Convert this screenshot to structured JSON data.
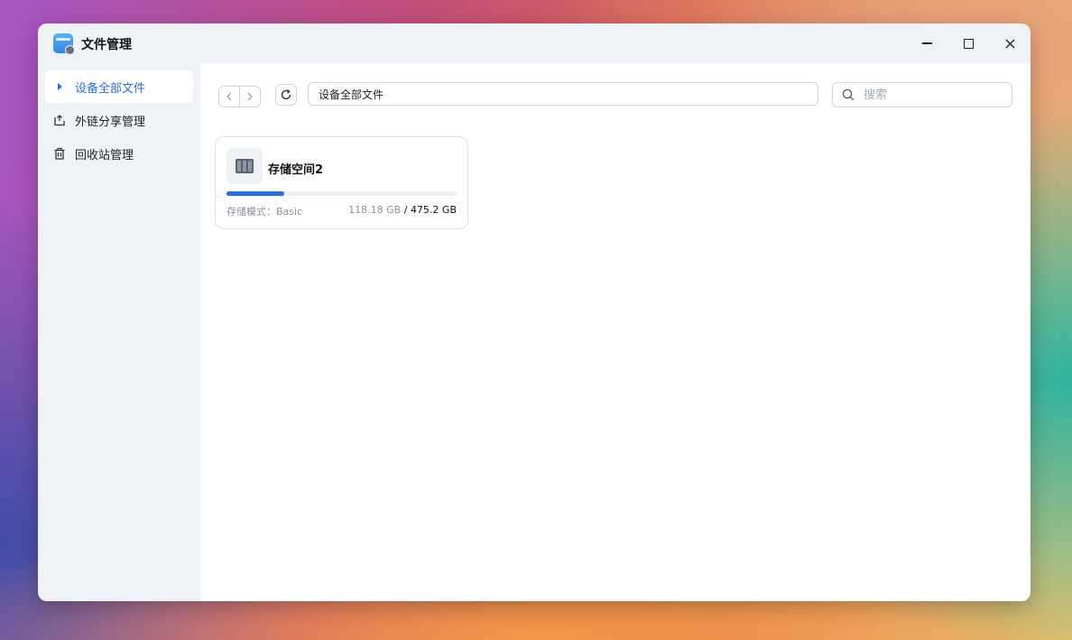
{
  "window": {
    "title": "文件管理",
    "controls": [
      "minimize",
      "maximize",
      "close"
    ]
  },
  "sidebar": {
    "items": [
      {
        "label": "设备全部文件",
        "icon": "triangle-right-icon",
        "active": true
      },
      {
        "label": "外链分享管理",
        "icon": "share-icon",
        "active": false
      },
      {
        "label": "回收站管理",
        "icon": "trash-icon",
        "active": false
      }
    ]
  },
  "toolbar": {
    "path": "设备全部文件",
    "search_placeholder": "搜索"
  },
  "storage": {
    "name": "存储空间2",
    "mode_label": "存储模式：Basic",
    "used": "118.18 GB",
    "separator": " / ",
    "total": "475.2 GB",
    "usage_fraction": 0.249
  },
  "colors": {
    "accent": "#2270e0"
  }
}
